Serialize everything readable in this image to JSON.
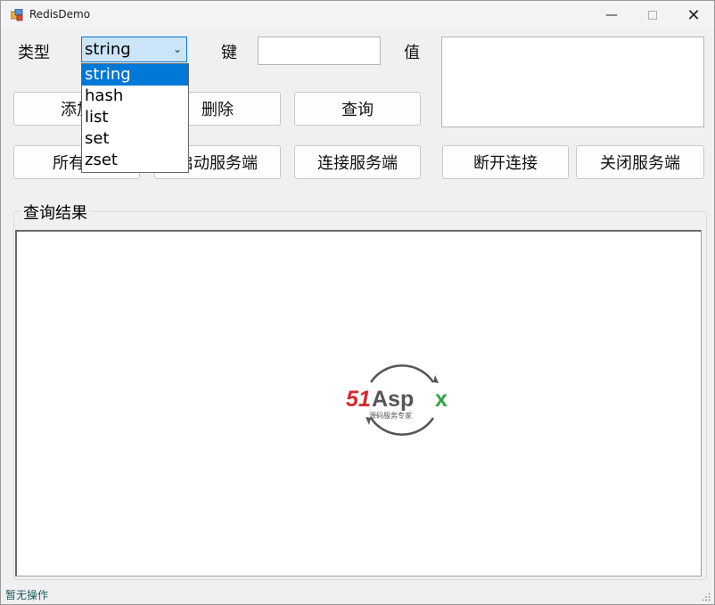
{
  "window": {
    "title": "RedisDemo"
  },
  "form": {
    "type_label": "类型",
    "type_selected": "string",
    "type_options": [
      "string",
      "hash",
      "list",
      "set",
      "zset"
    ],
    "key_label": "键",
    "key_value": "",
    "value_label": "值",
    "value_text": ""
  },
  "buttons": {
    "add": "添加",
    "delete": "删除",
    "query": "查询",
    "all_keys": "所有键",
    "start_server": "启动服务端",
    "connect_server": "连接服务端",
    "disconnect": "断开连接",
    "close_server": "关闭服务端"
  },
  "results": {
    "group_title": "查询结果"
  },
  "logo": {
    "brand": "51Aspx",
    "tagline": "源码服务专家"
  },
  "status": {
    "text": "暂无操作"
  },
  "colors": {
    "accent": "#0078d7",
    "logo_red": "#d6282c",
    "logo_green": "#35a344",
    "logo_gray": "#555555"
  }
}
